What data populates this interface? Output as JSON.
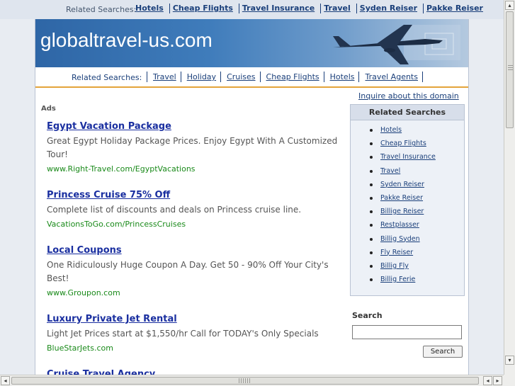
{
  "top_bar": {
    "label": "Related Searches:",
    "links": [
      "Hotels",
      "Cheap Flights",
      "Travel Insurance",
      "Travel",
      "Syden Reiser",
      "Pakke Reiser"
    ]
  },
  "banner": {
    "title": "globaltravel-us.com"
  },
  "subnav": {
    "label": "Related Searches:",
    "links": [
      "Travel",
      "Holiday",
      "Cruises",
      "Cheap Flights",
      "Hotels",
      "Travel Agents"
    ]
  },
  "inquire": "Inquire about this domain",
  "ads_label": "Ads",
  "ads": [
    {
      "title": "Egypt Vacation Package",
      "desc": "Great Egypt Holiday Package Prices. Enjoy Egypt With A Customized Tour!",
      "url": "www.Right-Travel.com/EgyptVacations"
    },
    {
      "title": "Princess Cruise 75% Off",
      "desc": "Complete list of discounts and deals on Princess cruise line.",
      "url": "VacationsToGo.com/PrincessCruises"
    },
    {
      "title": "Local Coupons",
      "desc": "One Ridiculously Huge Coupon A Day. Get 50 - 90% Off Your City's Best!",
      "url": "www.Groupon.com"
    },
    {
      "title": "Luxury Private Jet Rental",
      "desc": "Light Jet Prices start at $1,550/hr Call for TODAY's Only Specials",
      "url": "BlueStarJets.com"
    },
    {
      "title": "Cruise Travel Agency",
      "desc": "",
      "url": ""
    }
  ],
  "related_box": {
    "title": "Related Searches",
    "items": [
      "Hotels",
      "Cheap Flights",
      "Travel Insurance",
      "Travel",
      "Syden Reiser",
      "Pakke Reiser",
      "Billige Reiser",
      "Restplasser",
      "Billig Syden",
      "Fly Reiser",
      "Billig Fly",
      "Billig Ferie"
    ]
  },
  "search": {
    "label": "Search",
    "value": "",
    "button": "Search"
  },
  "scrollbars": {
    "left_arrow": "◂",
    "right_arrow": "▸",
    "up_arrow": "▴",
    "down_arrow": "▾"
  },
  "colors": {
    "link": "#1a3f7a",
    "ad_title": "#1a2fa0",
    "ad_url": "#1a8a1a",
    "accent": "#e3a43a"
  }
}
